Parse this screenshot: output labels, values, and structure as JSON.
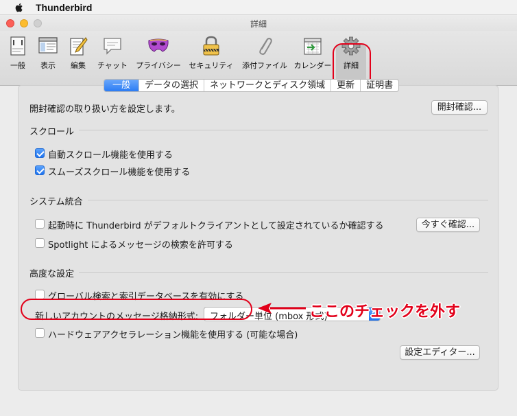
{
  "menubar": {
    "app_name": "Thunderbird"
  },
  "window": {
    "title": "詳細"
  },
  "toolbar": {
    "items": [
      {
        "label": "一般",
        "icon": "general-icon"
      },
      {
        "label": "表示",
        "icon": "display-icon"
      },
      {
        "label": "編集",
        "icon": "compose-icon"
      },
      {
        "label": "チャット",
        "icon": "chat-icon"
      },
      {
        "label": "プライバシー",
        "icon": "privacy-mask-icon"
      },
      {
        "label": "セキュリティ",
        "icon": "security-lock-icon"
      },
      {
        "label": "添付ファイル",
        "icon": "attachment-paperclip-icon"
      },
      {
        "label": "カレンダー",
        "icon": "calendar-icon"
      },
      {
        "label": "詳細",
        "icon": "advanced-gear-icon",
        "selected": true
      }
    ]
  },
  "tabs": [
    {
      "label": "一般",
      "active": true
    },
    {
      "label": "データの選択"
    },
    {
      "label": "ネットワークとディスク領域"
    },
    {
      "label": "更新"
    },
    {
      "label": "証明書"
    }
  ],
  "receipts": {
    "description": "開封確認の取り扱い方を設定します。",
    "button": "開封確認..."
  },
  "scroll": {
    "heading": "スクロール",
    "auto_scroll": {
      "label": "自動スクロール機能を使用する",
      "checked": true
    },
    "smooth_scroll": {
      "label": "スムーズスクロール機能を使用する",
      "checked": true
    }
  },
  "system": {
    "heading": "システム統合",
    "default_client": {
      "label": "起動時に Thunderbird がデフォルトクライアントとして設定されているか確認する",
      "checked": false
    },
    "check_now_button": "今すぐ確認...",
    "spotlight": {
      "label": "Spotlight によるメッセージの検索を許可する",
      "checked": false
    }
  },
  "advanced": {
    "heading": "高度な設定",
    "global_search": {
      "label": "グローバル検索と索引データベースを有効にする",
      "checked": false
    },
    "storage_label": "新しいアカウントのメッセージ格納形式:",
    "storage_value": "フォルダー単位 (mbox 形式)",
    "hw_accel": {
      "label": "ハードウェアアクセラレーション機能を使用する (可能な場合)",
      "checked": false
    },
    "config_editor_button": "設定エディター..."
  },
  "annotation": {
    "text": "ここのチェックを外す",
    "color": "#e2001a"
  }
}
